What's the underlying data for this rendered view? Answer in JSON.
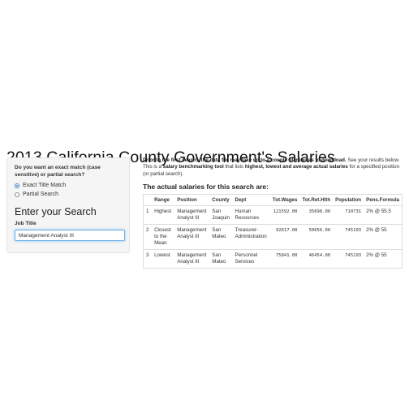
{
  "page": {
    "title": "2013 California County Government's Salaries"
  },
  "sidebar": {
    "question": "Do you want an exact match (case sensitive) or partial search?",
    "options": [
      {
        "label": "Exact Title Match",
        "checked": true
      },
      {
        "label": "Partial Search",
        "checked": false
      }
    ],
    "heading": "Enter your Search",
    "job_title_label": "Job Title",
    "job_title_value": "Management Analyst III"
  },
  "main": {
    "intro_bold": "Prior to the first search, the data file may take up to a couple of minutes to download.",
    "intro_rest_1": " See your results below. This is a ",
    "intro_bold_2": "salary benchmarking tool",
    "intro_rest_2": " that lists ",
    "intro_bold_3": "highest, lowest and average actual salaries",
    "intro_rest_3": " for a specified position (or partial search).",
    "results_heading": "The actual salaries for this search are:"
  },
  "table": {
    "headers": [
      "",
      "Range",
      "Position",
      "County",
      "Dept",
      "Tot.Wages",
      "Tot.Ret.Hlth",
      "Population",
      "Pens.Formula"
    ],
    "rows": [
      [
        "1",
        "Highest",
        "Management Analyst III",
        "San Joaquin",
        "Human Resources",
        "121592.00",
        "35698.00",
        "710731",
        "2% @ 55.5"
      ],
      [
        "2",
        "Closest to the Mean",
        "Management Analyst III",
        "San Mateo",
        "Treasurer-Administration",
        "92617.00",
        "50656.00",
        "745193",
        "2% @ 55"
      ],
      [
        "3",
        "Lowest",
        "Management Analyst III",
        "San Mateo",
        "Personnel Services",
        "75841.00",
        "46454.00",
        "745193",
        "2% @ 55"
      ]
    ]
  }
}
